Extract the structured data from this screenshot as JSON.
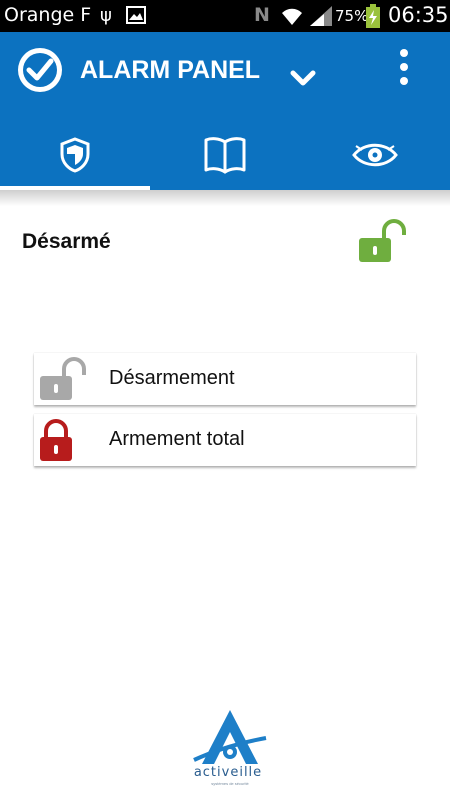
{
  "status_bar": {
    "carrier": "Orange F",
    "battery": "75%",
    "time": "06:35"
  },
  "app_bar": {
    "title": "ALARM PANEL",
    "tabs": [
      {
        "icon": "shield-icon"
      },
      {
        "icon": "book-icon"
      },
      {
        "icon": "eye-icon"
      }
    ],
    "active_tab": 0
  },
  "state": {
    "label": "Désarmé",
    "icon": "unlocked-padlock-icon"
  },
  "actions": [
    {
      "label": "Désarmement",
      "icon": "unlocked-padlock-icon"
    },
    {
      "label": "Armement total",
      "icon": "locked-padlock-icon"
    }
  ],
  "footer": {
    "brand": "activeille",
    "tagline": "systèmes de sécurité"
  },
  "colors": {
    "primary": "#0c72c0",
    "disarmed_green": "#6fae3f",
    "armed_red": "#b71c1c",
    "neutral_gray": "#a8a8a8"
  }
}
